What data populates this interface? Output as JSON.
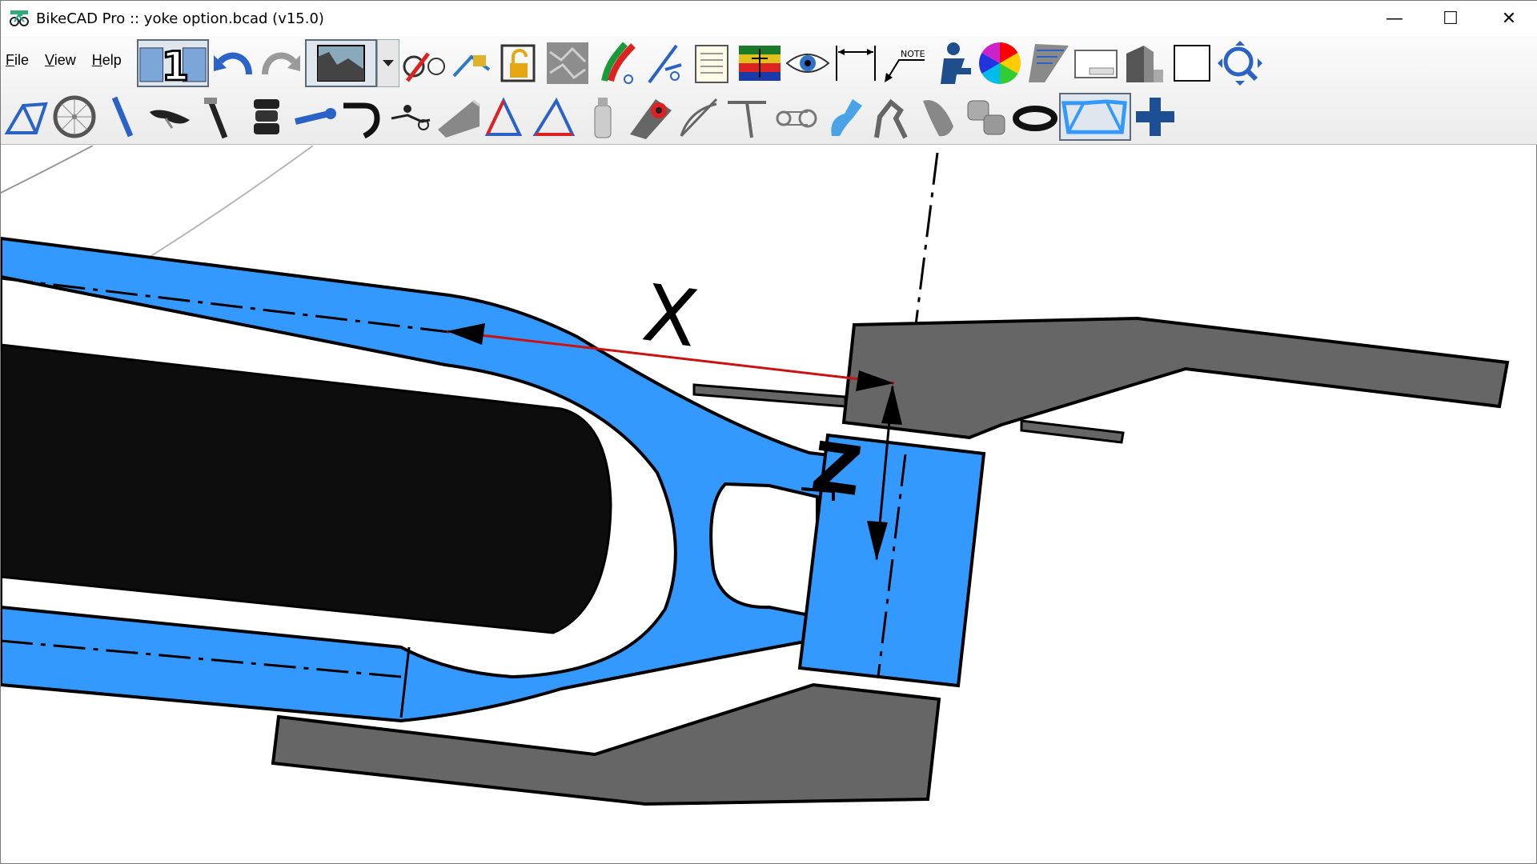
{
  "window": {
    "title": "BikeCAD Pro :: yoke option.bcad (v15.0)",
    "minimize_glyph": "—",
    "maximize_glyph": "☐",
    "close_glyph": "✕"
  },
  "menu": {
    "file_first": "F",
    "file_rest": "ile",
    "view_first": "V",
    "view_rest": "iew",
    "help_first": "H",
    "help_rest": "elp"
  },
  "toolbar": {
    "row1_icons": [
      "one-up-icon",
      "undo-icon",
      "redo-icon",
      "silhouette-icon",
      "dropdown-icon",
      "bike-arrow-icon",
      "lock-bike-icon",
      "padlock-icon",
      "texture-icon",
      "paint-icon",
      "compass-icon",
      "notepad-icon",
      "flag-icon",
      "eye-icon",
      "dimension-icon",
      "note-icon",
      "rider-icon",
      "color-wheel-icon",
      "ruler-icon",
      "panel-icon",
      "cad-block-icon",
      "blank-box-icon",
      "zoom-fit-icon"
    ],
    "row2_icons": [
      "frame-icon",
      "wheel-icon",
      "fork-icon",
      "saddle-icon",
      "seatpost-icon",
      "headset-icon",
      "stem-icon",
      "handlebar-icon",
      "rider-position-icon",
      "tube-icon",
      "frame-red-icon",
      "frame-red-2-icon",
      "bottle-icon",
      "tire-icon",
      "angle-icon",
      "t-square-icon",
      "drivetrain-icon",
      "brake-icon",
      "derailleur-icon",
      "tube-cut-icon",
      "bearing-icon",
      "chainring-icon",
      "yoke-frame-icon",
      "add-icon"
    ],
    "note_label": "NOTE"
  },
  "drawing": {
    "label_x": "X",
    "label_z": "Z",
    "colors": {
      "tube": "#3399ff",
      "gray_part": "#666666",
      "tire": "#0d0d0d",
      "dimension": "#cc1111"
    }
  }
}
